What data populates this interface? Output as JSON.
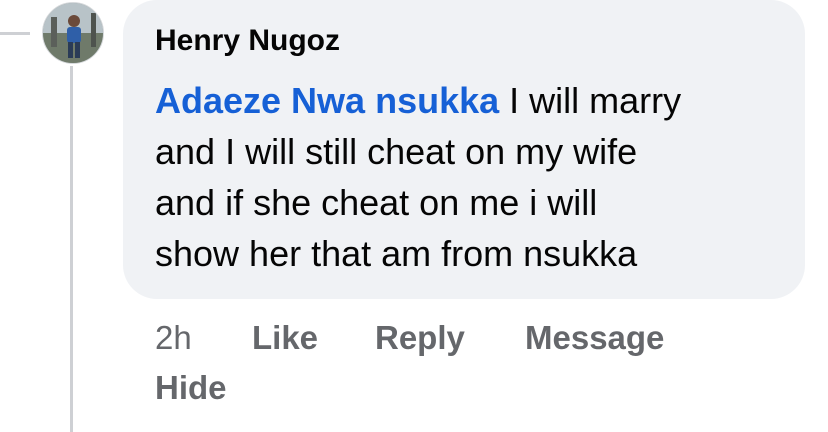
{
  "comment": {
    "author": "Henry Nugoz",
    "mention": "Adaeze Nwa nsukka",
    "lines": [
      " I will marry",
      "and I will still cheat on my wife",
      "and if she cheat on me i will",
      "show her that am from nsukka"
    ]
  },
  "actions": {
    "time": "2h",
    "like": "Like",
    "reply": "Reply",
    "message": "Message",
    "hide": "Hide"
  },
  "colors": {
    "bubble": "#f0f2f5",
    "mention": "#1660d6",
    "action_text": "#65676b",
    "thread_line": "#ced0d4"
  }
}
